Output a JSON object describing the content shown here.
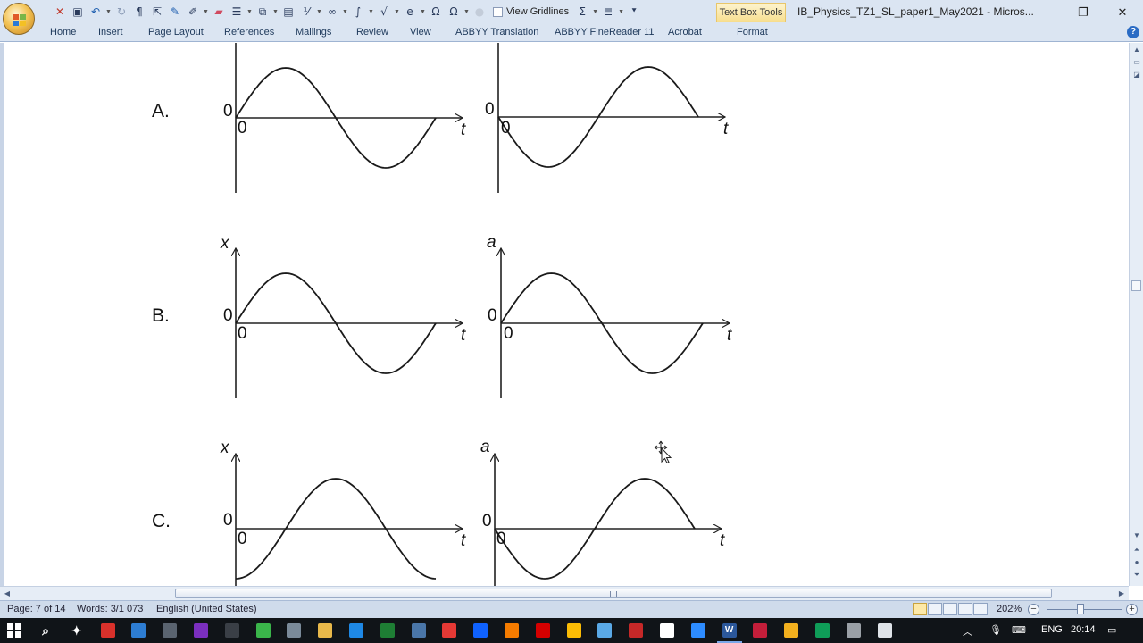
{
  "window": {
    "title": "IB_Physics_TZ1_SL_paper1_May2021 - Micros...",
    "contextual_tab": "Text Box Tools",
    "controls": [
      "minimize",
      "restore",
      "close"
    ]
  },
  "quick_access": {
    "view_gridlines_label": "View Gridlines",
    "icons": [
      "delete-icon",
      "save-icon",
      "undo-icon",
      "redo-icon",
      "pilcrow-icon",
      "select-icon",
      "pen-icon",
      "highlighter-icon",
      "eraser-icon",
      "lines-icon",
      "shapes-icon",
      "textbox-icon",
      "fraction-icon",
      "infinity-icon",
      "integral-icon",
      "root-icon",
      "exponent-icon",
      "omega-icon",
      "omega-icon",
      "circle-icon",
      "sigma-icon",
      "equation-icon"
    ]
  },
  "ribbon": {
    "tabs": [
      "Home",
      "Insert",
      "Page Layout",
      "References",
      "Mailings",
      "Review",
      "View",
      "ABBYY Translation",
      "ABBYY FineReader 11",
      "Acrobat",
      "Format"
    ]
  },
  "document": {
    "options": [
      {
        "label": "A.",
        "left_graph_ylabel": "",
        "right_graph_ylabel": ""
      },
      {
        "label": "B.",
        "left_graph_ylabel": "x",
        "right_graph_ylabel": "a"
      },
      {
        "label": "C.",
        "left_graph_ylabel": "x",
        "right_graph_ylabel": "a"
      }
    ],
    "axis_origin": "0",
    "axis_time": "t"
  },
  "statusbar": {
    "page": "Page: 7 of 14",
    "words": "Words: 3/1 073",
    "language": "English (United States)",
    "zoom": "202%",
    "zoom_level_percent": 202
  },
  "taskbar": {
    "language": "ENG",
    "time": "20:14",
    "apps": [
      "search-icon",
      "pin-icon",
      "pdf-icon",
      "app-icon",
      "calculator-icon",
      "onenote-icon",
      "phone-icon",
      "tree-icon",
      "globe-icon",
      "media-icon",
      "closed-caption-icon",
      "excel-icon",
      "camera-icon",
      "record-icon",
      "mail-icon",
      "vlc-icon",
      "opera-icon",
      "chrome-icon",
      "notes-icon",
      "dragon-icon",
      "cloud-icon",
      "zoom-icon",
      "word-icon",
      "acrobat-icon",
      "folder-icon",
      "edge-icon",
      "copyright-icon",
      "check-icon"
    ]
  }
}
